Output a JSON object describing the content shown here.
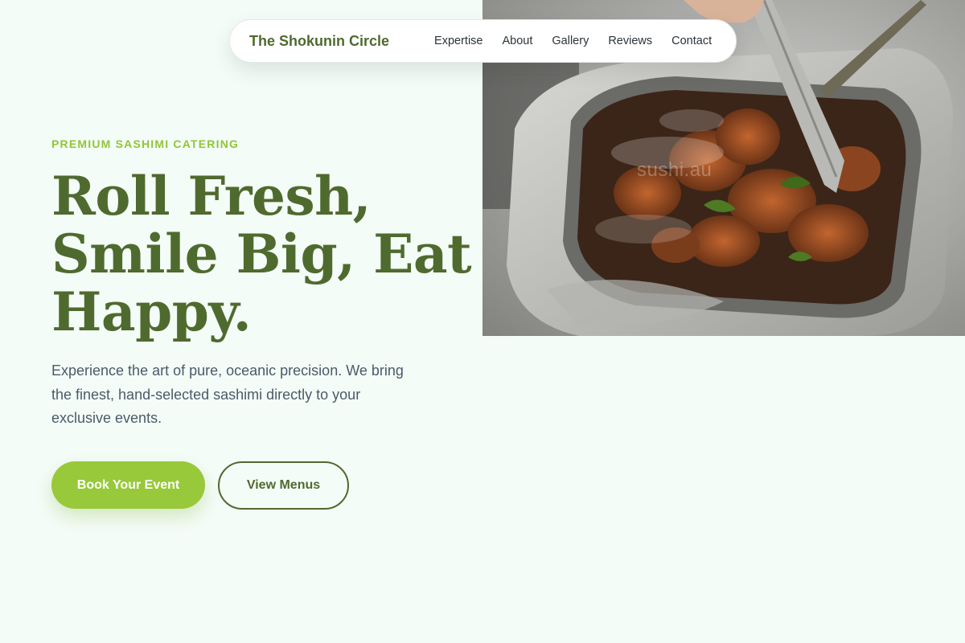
{
  "nav": {
    "brand": "The Shokunin Circle",
    "links": [
      "Expertise",
      "About",
      "Gallery",
      "Reviews",
      "Contact"
    ]
  },
  "hero": {
    "eyebrow": "PREMIUM SASHIMI CATERING",
    "headline_lines": [
      "Roll Fresh,",
      "Smile Big, Eat",
      "Happy."
    ],
    "intro": "Experience the art of pure, oceanic precision. We bring the finest, hand-selected sashimi directly to your exclusive events.",
    "primary_button": "Book Your Event",
    "secondary_button": "View Menus",
    "image_watermark": "sushi.au"
  },
  "colors": {
    "background": "#f4fcf7",
    "brand_green": "#4f6a2e",
    "accent_lime": "#97c93a",
    "eyebrow_lime": "#8fc638",
    "body_text": "#4b5a6a"
  },
  "icons": {
    "hero_image": "grilled-meat-tray-with-tongs-photo"
  }
}
